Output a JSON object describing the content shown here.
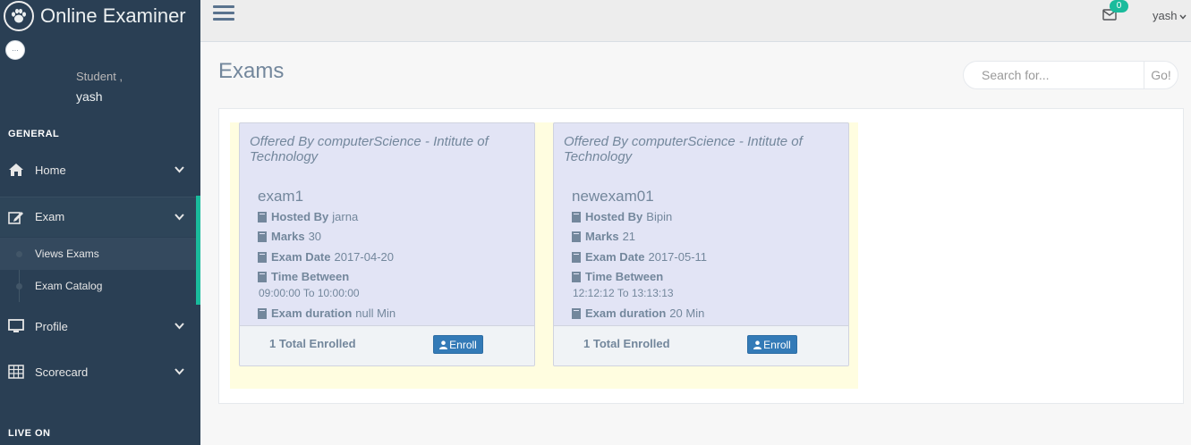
{
  "app": {
    "title": "Online Examiner"
  },
  "sidebar": {
    "avatar_text": "...",
    "welcome": "Student ,",
    "username": "yash",
    "sections": {
      "general": "GENERAL",
      "live": "LIVE ON"
    },
    "items": [
      {
        "label": "Home",
        "icon": "home-icon"
      },
      {
        "label": "Exam",
        "icon": "edit-icon"
      },
      {
        "label": "Profile",
        "icon": "desktop-icon"
      },
      {
        "label": "Scorecard",
        "icon": "table-icon"
      }
    ],
    "exam_sub": [
      {
        "label": "Views Exams"
      },
      {
        "label": "Exam Catalog"
      }
    ]
  },
  "topbar": {
    "mail_count": "0",
    "user": "yash"
  },
  "page": {
    "title": "Exams"
  },
  "search": {
    "placeholder": "Search for...",
    "button": "Go!"
  },
  "colors": {
    "accent": "#1ABB9C",
    "sidebar": "#2A3F54",
    "card": "#E2E4F5",
    "button": "#337AB7"
  },
  "exams": [
    {
      "offered": "Offered By computerScience - Intitute of Technology",
      "name": "exam1",
      "hosted_label": "Hosted By",
      "hosted": "jarna",
      "marks_label": "Marks",
      "marks": "30",
      "date_label": "Exam Date",
      "date": "2017-04-20",
      "time_label": "Time Between",
      "time": "09:00:00 To 10:00:00",
      "duration_label": "Exam duration",
      "duration": "null Min",
      "enrolled": "1 Total Enrolled",
      "enroll_button": "Enroll"
    },
    {
      "offered": "Offered By computerScience - Intitute of Technology",
      "name": "newexam01",
      "hosted_label": "Hosted By",
      "hosted": "Bipin",
      "marks_label": "Marks",
      "marks": "21",
      "date_label": "Exam Date",
      "date": "2017-05-11",
      "time_label": "Time Between",
      "time": "12:12:12 To 13:13:13",
      "duration_label": "Exam duration",
      "duration": "20 Min",
      "enrolled": "1 Total Enrolled",
      "enroll_button": "Enroll"
    }
  ]
}
